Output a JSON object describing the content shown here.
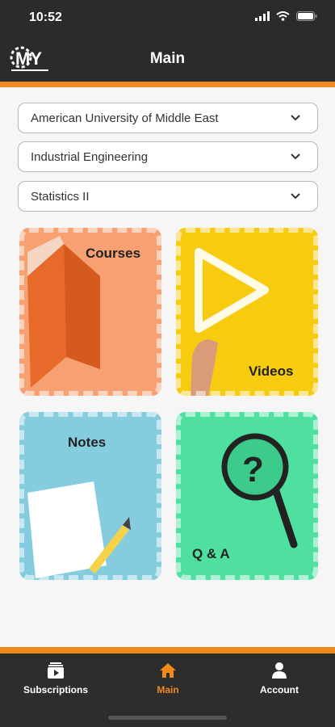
{
  "status": {
    "time": "10:52"
  },
  "header": {
    "title": "Main",
    "logo_text": "MY"
  },
  "dropdowns": [
    {
      "value": "American University of Middle East"
    },
    {
      "value": "Industrial Engineering"
    },
    {
      "value": "Statistics II"
    }
  ],
  "cards": {
    "courses": "Courses",
    "videos": "Videos",
    "notes": "Notes",
    "qa": "Q & A"
  },
  "tabs": [
    {
      "label": "Subscriptions",
      "icon": "subscriptions-icon",
      "active": false
    },
    {
      "label": "Main",
      "icon": "home-icon",
      "active": true
    },
    {
      "label": "Account",
      "icon": "person-icon",
      "active": false
    }
  ],
  "colors": {
    "accent": "#f08a1c",
    "header": "#2b2b2b",
    "courses": "#f7a071",
    "videos": "#f6cb10",
    "notes": "#86ccdf",
    "qa": "#4fe0a0"
  }
}
